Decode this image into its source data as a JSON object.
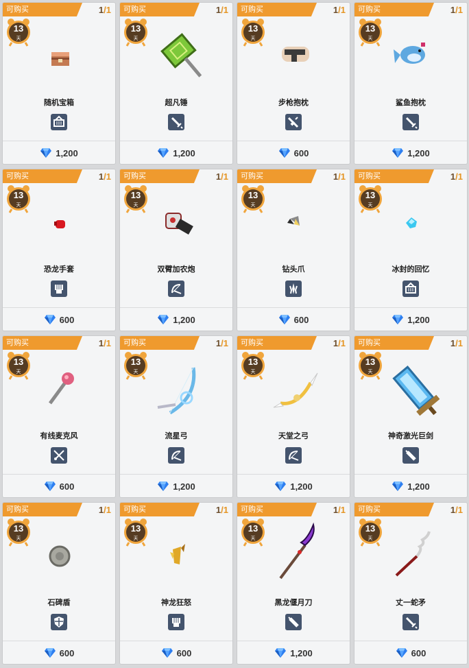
{
  "colors": {
    "ribbon": "#ef9a2e",
    "stock_text": "#6b4d2c",
    "stock_max": "#e59524",
    "timer_fill": "#563c22",
    "timer_ring": "#f0a53c",
    "type_icon_bg": "#44546d",
    "diamond": "#2e7ff0"
  },
  "items": [
    {
      "tag": "可购买",
      "stock_current": "1",
      "stock_sep": "/",
      "stock_max": "1",
      "days": "13",
      "day_unit": "天",
      "name": "随机宝箱",
      "type_icon": "basket-icon",
      "price": "1,200",
      "art": "chest-icon"
    },
    {
      "tag": "可购买",
      "stock_current": "1",
      "stock_sep": "/",
      "stock_max": "1",
      "days": "13",
      "day_unit": "天",
      "name": "超凡锤",
      "type_icon": "sword-icon",
      "price": "1,200",
      "art": "hammer-icon"
    },
    {
      "tag": "可购买",
      "stock_current": "1",
      "stock_sep": "/",
      "stock_max": "1",
      "days": "13",
      "day_unit": "天",
      "name": "步枪抱枕",
      "type_icon": "rifle-icon",
      "price": "600",
      "art": "gun-pillow-icon"
    },
    {
      "tag": "可购买",
      "stock_current": "1",
      "stock_sep": "/",
      "stock_max": "1",
      "days": "13",
      "day_unit": "天",
      "name": "鲨鱼抱枕",
      "type_icon": "sword-icon",
      "price": "1,200",
      "art": "shark-pillow-icon"
    },
    {
      "tag": "可购买",
      "stock_current": "1",
      "stock_sep": "/",
      "stock_max": "1",
      "days": "13",
      "day_unit": "天",
      "name": "恐龙手套",
      "type_icon": "fist-icon",
      "price": "600",
      "art": "glove-icon"
    },
    {
      "tag": "可购买",
      "stock_current": "1",
      "stock_sep": "/",
      "stock_max": "1",
      "days": "13",
      "day_unit": "天",
      "name": "双臂加农炮",
      "type_icon": "bow-icon",
      "price": "1,200",
      "art": "cannon-icon"
    },
    {
      "tag": "可购买",
      "stock_current": "1",
      "stock_sep": "/",
      "stock_max": "1",
      "days": "13",
      "day_unit": "天",
      "name": "钻头爪",
      "type_icon": "claw-icon",
      "price": "600",
      "art": "drill-icon"
    },
    {
      "tag": "可购买",
      "stock_current": "1",
      "stock_sep": "/",
      "stock_max": "1",
      "days": "13",
      "day_unit": "天",
      "name": "冰封的回忆",
      "type_icon": "basket-icon",
      "price": "1,200",
      "art": "ice-gem-icon"
    },
    {
      "tag": "可购买",
      "stock_current": "1",
      "stock_sep": "/",
      "stock_max": "1",
      "days": "13",
      "day_unit": "天",
      "name": "有线麦克风",
      "type_icon": "tools-icon",
      "price": "600",
      "art": "microphone-icon"
    },
    {
      "tag": "可购买",
      "stock_current": "1",
      "stock_sep": "/",
      "stock_max": "1",
      "days": "13",
      "day_unit": "天",
      "name": "流星弓",
      "type_icon": "bow-icon",
      "price": "1,200",
      "art": "meteor-bow-icon"
    },
    {
      "tag": "可购买",
      "stock_current": "1",
      "stock_sep": "/",
      "stock_max": "1",
      "days": "13",
      "day_unit": "天",
      "name": "天堂之弓",
      "type_icon": "bow-icon",
      "price": "1,200",
      "art": "heaven-bow-icon"
    },
    {
      "tag": "可购买",
      "stock_current": "1",
      "stock_sep": "/",
      "stock_max": "1",
      "days": "13",
      "day_unit": "天",
      "name": "神奇激光巨剑",
      "type_icon": "greatsword-icon",
      "price": "1,200",
      "art": "laser-sword-icon"
    },
    {
      "tag": "可购买",
      "stock_current": "1",
      "stock_sep": "/",
      "stock_max": "1",
      "days": "13",
      "day_unit": "天",
      "name": "石碑盾",
      "type_icon": "shield-icon",
      "price": "600",
      "art": "stone-shield-icon"
    },
    {
      "tag": "可购买",
      "stock_current": "1",
      "stock_sep": "/",
      "stock_max": "1",
      "days": "13",
      "day_unit": "天",
      "name": "神龙狂怒",
      "type_icon": "fist-icon",
      "price": "600",
      "art": "dragon-claw-icon"
    },
    {
      "tag": "可购买",
      "stock_current": "1",
      "stock_sep": "/",
      "stock_max": "1",
      "days": "13",
      "day_unit": "天",
      "name": "黑龙偃月刀",
      "type_icon": "greatsword-icon",
      "price": "1,200",
      "art": "glaive-icon"
    },
    {
      "tag": "可购买",
      "stock_current": "1",
      "stock_sep": "/",
      "stock_max": "1",
      "days": "13",
      "day_unit": "天",
      "name": "丈一蛇矛",
      "type_icon": "sword-icon",
      "price": "600",
      "art": "snake-spear-icon"
    }
  ]
}
